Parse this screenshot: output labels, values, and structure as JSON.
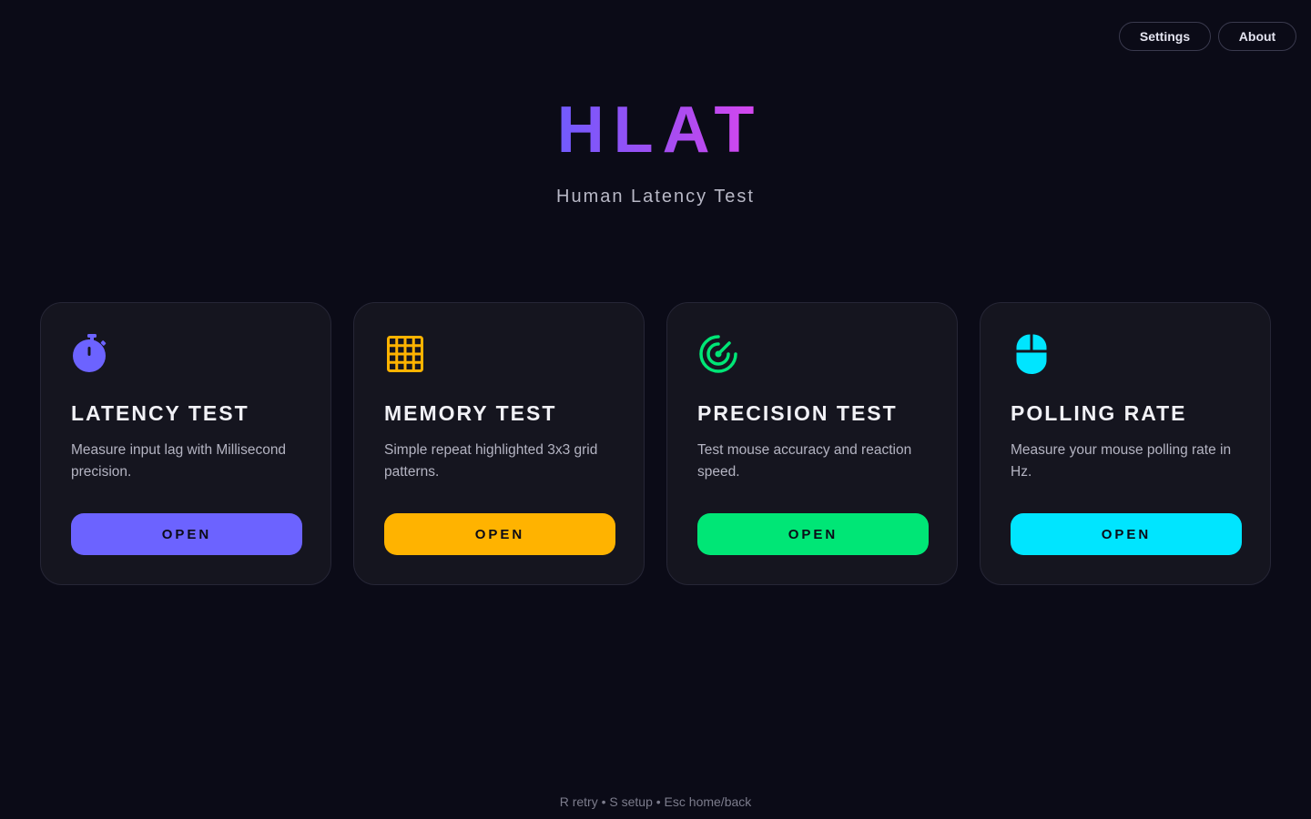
{
  "nav": {
    "settings_label": "Settings",
    "about_label": "About"
  },
  "header": {
    "logo": "HLAT",
    "subtitle": "Human Latency Test"
  },
  "cards": [
    {
      "title": "LATENCY TEST",
      "description": "Measure input lag with Millisecond precision.",
      "button_label": "OPEN",
      "icon": "stopwatch-icon",
      "accent": "#6c63ff"
    },
    {
      "title": "MEMORY TEST",
      "description": "Simple repeat highlighted 3x3 grid patterns.",
      "button_label": "OPEN",
      "icon": "grid-icon",
      "accent": "#ffb300"
    },
    {
      "title": "PRECISION TEST",
      "description": "Test mouse accuracy and reaction speed.",
      "button_label": "OPEN",
      "icon": "radar-icon",
      "accent": "#00e676"
    },
    {
      "title": "POLLING RATE",
      "description": "Measure your mouse polling rate in Hz.",
      "button_label": "OPEN",
      "icon": "mouse-icon",
      "accent": "#00e5ff"
    }
  ],
  "footer": {
    "shortcuts": "R retry • S setup • Esc home/back"
  }
}
